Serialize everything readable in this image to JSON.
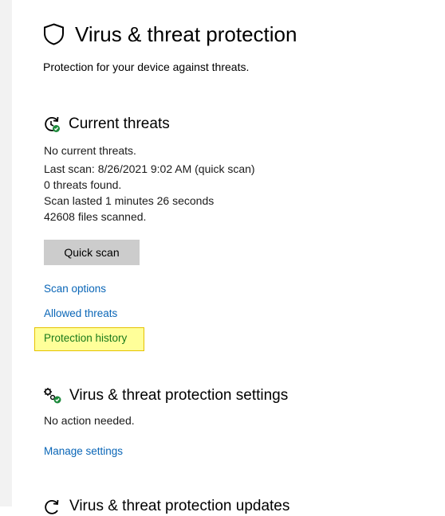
{
  "header": {
    "title": "Virus & threat protection",
    "subtitle": "Protection for your device against threats."
  },
  "current_threats": {
    "title": "Current threats",
    "status": "No current threats.",
    "last_scan": "Last scan: 8/26/2021 9:02 AM (quick scan)",
    "threats_found": "0 threats found.",
    "scan_duration": "Scan lasted 1 minutes 26 seconds",
    "files_scanned": "42608 files scanned.",
    "quick_scan_label": "Quick scan",
    "links": {
      "scan_options": "Scan options",
      "allowed_threats": "Allowed threats",
      "protection_history": "Protection history"
    }
  },
  "settings_section": {
    "title": "Virus & threat protection settings",
    "status": "No action needed.",
    "manage_link": "Manage settings"
  },
  "updates_section": {
    "title": "Virus & threat protection updates"
  },
  "colors": {
    "link": "#0a66b7",
    "button_bg": "#cccccc",
    "highlight_fill": "#ffff99",
    "highlight_border": "#e6c200",
    "status_ok_green": "#1e8a3c"
  },
  "icons": {
    "header": "shield-icon",
    "current_threats": "refresh-check-icon",
    "settings": "gears-check-icon",
    "updates": "refresh-icon"
  }
}
